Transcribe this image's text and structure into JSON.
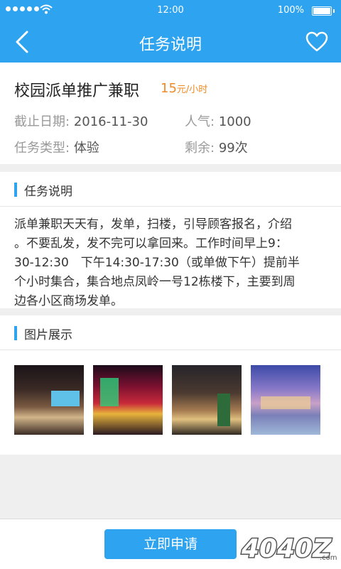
{
  "status_bar": {
    "time": "12:00",
    "battery": "100%"
  },
  "nav": {
    "title": "任务说明",
    "back_icon": "chevron-left-icon",
    "fav_icon": "heart-icon"
  },
  "job": {
    "title": "校园派单推广兼职",
    "salary": "15",
    "salary_unit": "元/小时",
    "deadline_label": "截止日期:",
    "deadline": "2016-11-30",
    "popularity_label": "人气:",
    "popularity": "1000",
    "type_label": "任务类型:",
    "type": "体验",
    "remaining_label": "剩余:",
    "remaining": "99次"
  },
  "description": {
    "heading": "任务说明",
    "lines": [
      "派单兼职天天有，发单，扫楼，引导顾客报名，介绍",
      "。不要乱发，发不完可以拿回来。工作时间早上9：",
      "30-12:30　下午14:30-17:30（或单做下午）提前半",
      "个小时集合，集合地点凤岭一号12栋楼下，主要到周",
      "边各小区商场发单。"
    ]
  },
  "gallery": {
    "heading": "图片展示",
    "photos": [
      "mall-storefront-photo",
      "neon-street-photo",
      "city-street-night-photo",
      "plaza-dusk-photo"
    ]
  },
  "footer": {
    "apply_label": "立即申请",
    "watermark": "4040Z.com"
  },
  "colors": {
    "primary": "#2ea3ef",
    "accent": "#f08a24"
  }
}
